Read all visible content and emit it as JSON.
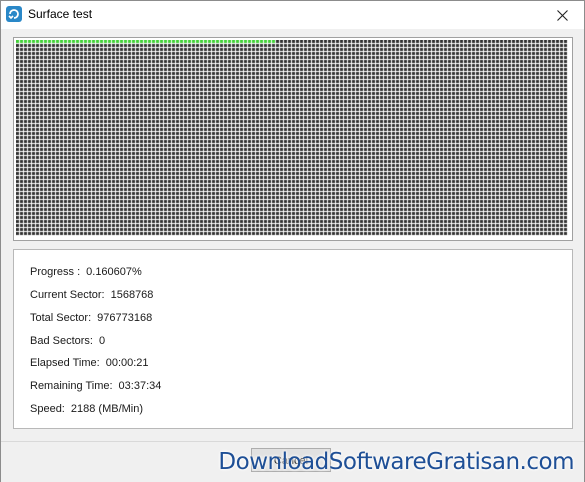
{
  "window": {
    "title": "Surface test",
    "app_icon": "partition-tool-icon",
    "close_icon": "close-icon"
  },
  "surface_map": {
    "scanned_fraction": 0.0016,
    "colors": {
      "unscanned_block": "#333333",
      "good_block": "#44d33a",
      "grid_line": "#ffffff"
    }
  },
  "stats": {
    "progress": {
      "label": "Progress :",
      "value": "0.160607%"
    },
    "current_sector": {
      "label": "Current Sector:",
      "value": "1568768"
    },
    "total_sector": {
      "label": "Total Sector:",
      "value": "976773168"
    },
    "bad_sectors": {
      "label": "Bad Sectors:",
      "value": "0"
    },
    "elapsed_time": {
      "label": "Elapsed Time:",
      "value": "00:00:21"
    },
    "remaining_time": {
      "label": "Remaining Time:",
      "value": "03:37:34"
    },
    "speed": {
      "label": "Speed:",
      "value": "2188 (MB/Min)"
    }
  },
  "buttons": {
    "cancel_label": "Cancel"
  },
  "watermark": {
    "text": "DownloadSoftwareGratisan.com",
    "color": "#1e4f96"
  }
}
